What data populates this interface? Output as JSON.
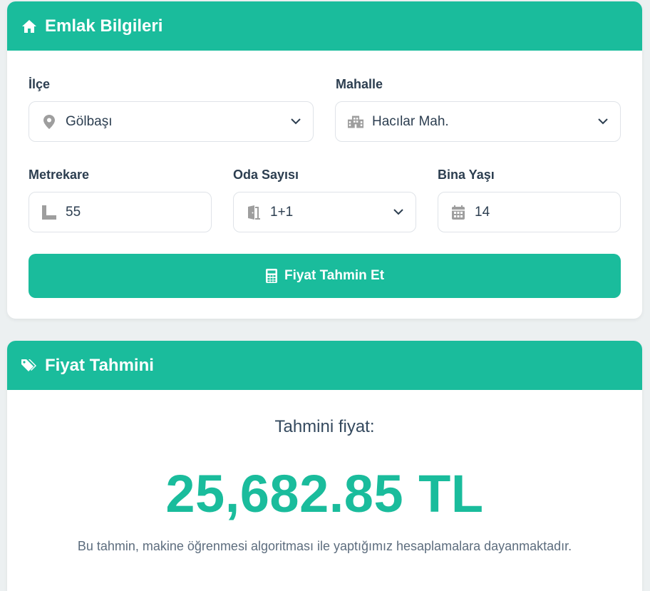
{
  "colors": {
    "accent": "#1abc9c",
    "background": "#ecf0f1",
    "text": "#2c3e50",
    "icon_gray": "#9e9e9e"
  },
  "property_card": {
    "title": "Emlak Bilgileri",
    "header_icon": "home-icon",
    "district": {
      "label": "İlçe",
      "value": "Gölbaşı",
      "icon": "map-pin-icon"
    },
    "neighborhood": {
      "label": "Mahalle",
      "value": "Hacılar Mah.",
      "icon": "building-icon"
    },
    "area": {
      "label": "Metrekare",
      "value": "55",
      "icon": "ruler-icon"
    },
    "rooms": {
      "label": "Oda Sayısı",
      "value": "1+1",
      "icon": "door-icon"
    },
    "building_age": {
      "label": "Bina Yaşı",
      "value": "14",
      "icon": "calendar-icon"
    },
    "submit_button": {
      "label": "Fiyat Tahmin Et",
      "icon": "calculator-icon"
    }
  },
  "price_card": {
    "title": "Fiyat Tahmini",
    "header_icon": "tags-icon",
    "result_label": "Tahmini fiyat:",
    "result_value": "25,682.85 TL",
    "note": "Bu tahmin, makine öğrenmesi algoritması ile yaptığımız hesaplamalara dayanmaktadır."
  }
}
